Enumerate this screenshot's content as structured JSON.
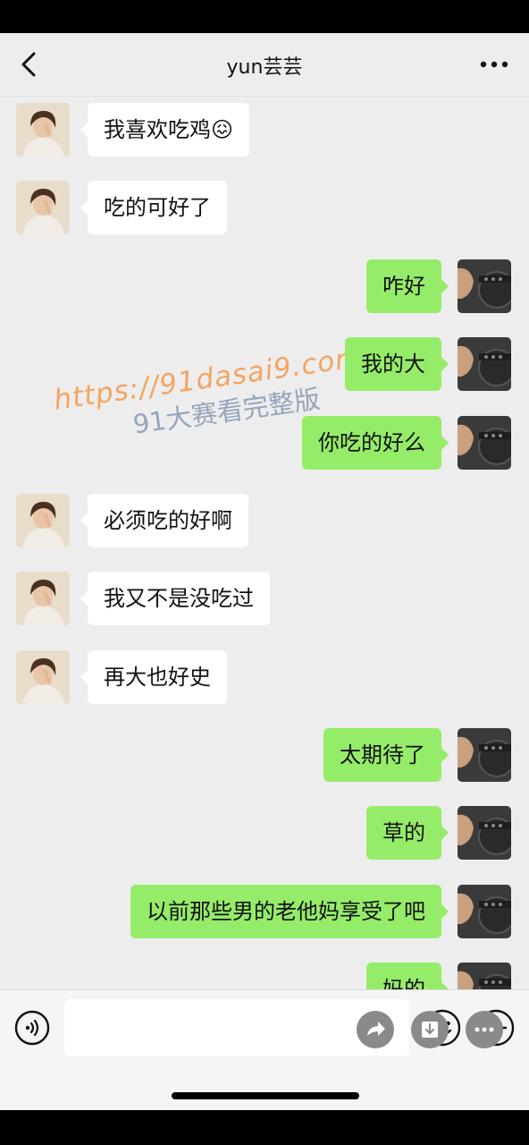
{
  "header": {
    "title": "yun芸芸"
  },
  "messages": [
    {
      "side": "in",
      "text": "我喜欢吃鸡😖"
    },
    {
      "side": "in",
      "text": "吃的可好了"
    },
    {
      "side": "out",
      "text": "咋好"
    },
    {
      "side": "out",
      "text": "我的大"
    },
    {
      "side": "out",
      "text": "你吃的好么"
    },
    {
      "side": "in",
      "text": "必须吃的好啊"
    },
    {
      "side": "in",
      "text": "我又不是没吃过"
    },
    {
      "side": "in",
      "text": "再大也好史"
    },
    {
      "side": "out",
      "text": "太期待了"
    },
    {
      "side": "out",
      "text": "草的"
    },
    {
      "side": "out",
      "text": "以前那些男的老他妈享受了吧"
    },
    {
      "side": "out",
      "text": "妈的"
    }
  ],
  "watermark": {
    "url": "https://91dasai9.com",
    "caption": "91大赛看完整版"
  },
  "colors": {
    "outgoing_bubble": "#95ec69",
    "incoming_bubble": "#ffffff",
    "background": "#ededed"
  },
  "icons": {
    "back": "chevron-left-icon",
    "more": "more-dots-icon",
    "voice": "voice-icon",
    "emoji": "emoji-icon",
    "plus": "plus-icon",
    "share": "share-icon",
    "download": "download-icon",
    "menu": "more-icon"
  }
}
